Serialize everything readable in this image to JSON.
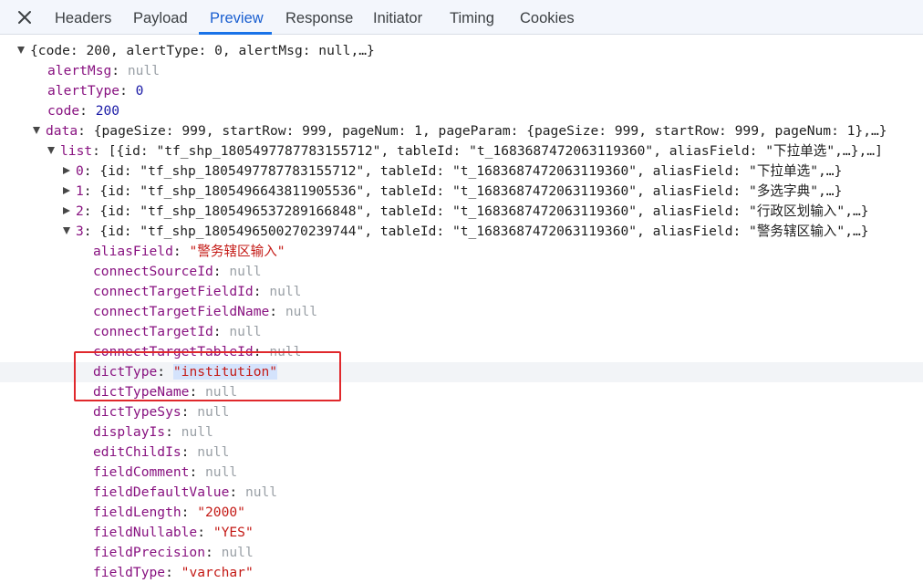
{
  "tabs": [
    {
      "label": "Headers",
      "active": false
    },
    {
      "label": "Payload",
      "active": false
    },
    {
      "label": "Preview",
      "active": true
    },
    {
      "label": "Response",
      "active": false
    },
    {
      "label": "Initiator",
      "active": false
    },
    {
      "label": "Timing",
      "active": false
    },
    {
      "label": "Cookies",
      "active": false
    }
  ],
  "tree": {
    "root_preview": "{code: 200, alertType: 0, alertMsg: null,…}",
    "alertMsg": {
      "key": "alertMsg",
      "value": "null"
    },
    "alertType": {
      "key": "alertType",
      "value": "0"
    },
    "code": {
      "key": "code",
      "value": "200"
    },
    "data": {
      "key": "data",
      "preview": "{pageSize: 999, startRow: 999, pageNum: 1, pageParam: {pageSize: 999, startRow: 999, pageNum: 1},…}",
      "list": {
        "key": "list",
        "preview": "[{id: \"tf_shp_1805497787783155712\", tableId: \"t_1683687472063119360\", aliasField: \"下拉单选\",…},…]",
        "items": [
          {
            "index": "0",
            "preview": "{id: \"tf_shp_1805497787783155712\", tableId: \"t_1683687472063119360\", aliasField: \"下拉单选\",…}"
          },
          {
            "index": "1",
            "preview": "{id: \"tf_shp_1805496643811905536\", tableId: \"t_1683687472063119360\", aliasField: \"多选字典\",…}"
          },
          {
            "index": "2",
            "preview": "{id: \"tf_shp_1805496537289166848\", tableId: \"t_1683687472063119360\", aliasField: \"行政区划输入\",…}"
          },
          {
            "index": "3",
            "preview": "{id: \"tf_shp_1805496500270239744\", tableId: \"t_1683687472063119360\", aliasField: \"警务辖区输入\",…}"
          }
        ],
        "item3_fields": [
          {
            "key": "aliasField",
            "value": "\"警务辖区输入\"",
            "type": "str"
          },
          {
            "key": "connectSourceId",
            "value": "null",
            "type": "null"
          },
          {
            "key": "connectTargetFieldId",
            "value": "null",
            "type": "null"
          },
          {
            "key": "connectTargetFieldName",
            "value": "null",
            "type": "null"
          },
          {
            "key": "connectTargetId",
            "value": "null",
            "type": "null"
          },
          {
            "key": "connectTargetTableId",
            "value": "null",
            "type": "null"
          },
          {
            "key": "dictType",
            "value": "\"institution\"",
            "type": "str"
          },
          {
            "key": "dictTypeName",
            "value": "null",
            "type": "null"
          },
          {
            "key": "dictTypeSys",
            "value": "null",
            "type": "null"
          },
          {
            "key": "displayIs",
            "value": "null",
            "type": "null"
          },
          {
            "key": "editChildIs",
            "value": "null",
            "type": "null"
          },
          {
            "key": "fieldComment",
            "value": "null",
            "type": "null"
          },
          {
            "key": "fieldDefaultValue",
            "value": "null",
            "type": "null"
          },
          {
            "key": "fieldLength",
            "value": "\"2000\"",
            "type": "str"
          },
          {
            "key": "fieldNullable",
            "value": "\"YES\"",
            "type": "str"
          },
          {
            "key": "fieldPrecision",
            "value": "null",
            "type": "null"
          },
          {
            "key": "fieldType",
            "value": "\"varchar\"",
            "type": "str"
          }
        ]
      }
    }
  },
  "colors": {
    "key": "#881280",
    "number": "#1a1aa6",
    "string": "#c41a16",
    "null": "#9aa0a6",
    "active_tab": "#1a73e8",
    "highlight_box": "#e0282c"
  },
  "icons": {
    "close": "close-icon",
    "expanded": "triangle-down-icon",
    "collapsed": "triangle-right-icon"
  }
}
